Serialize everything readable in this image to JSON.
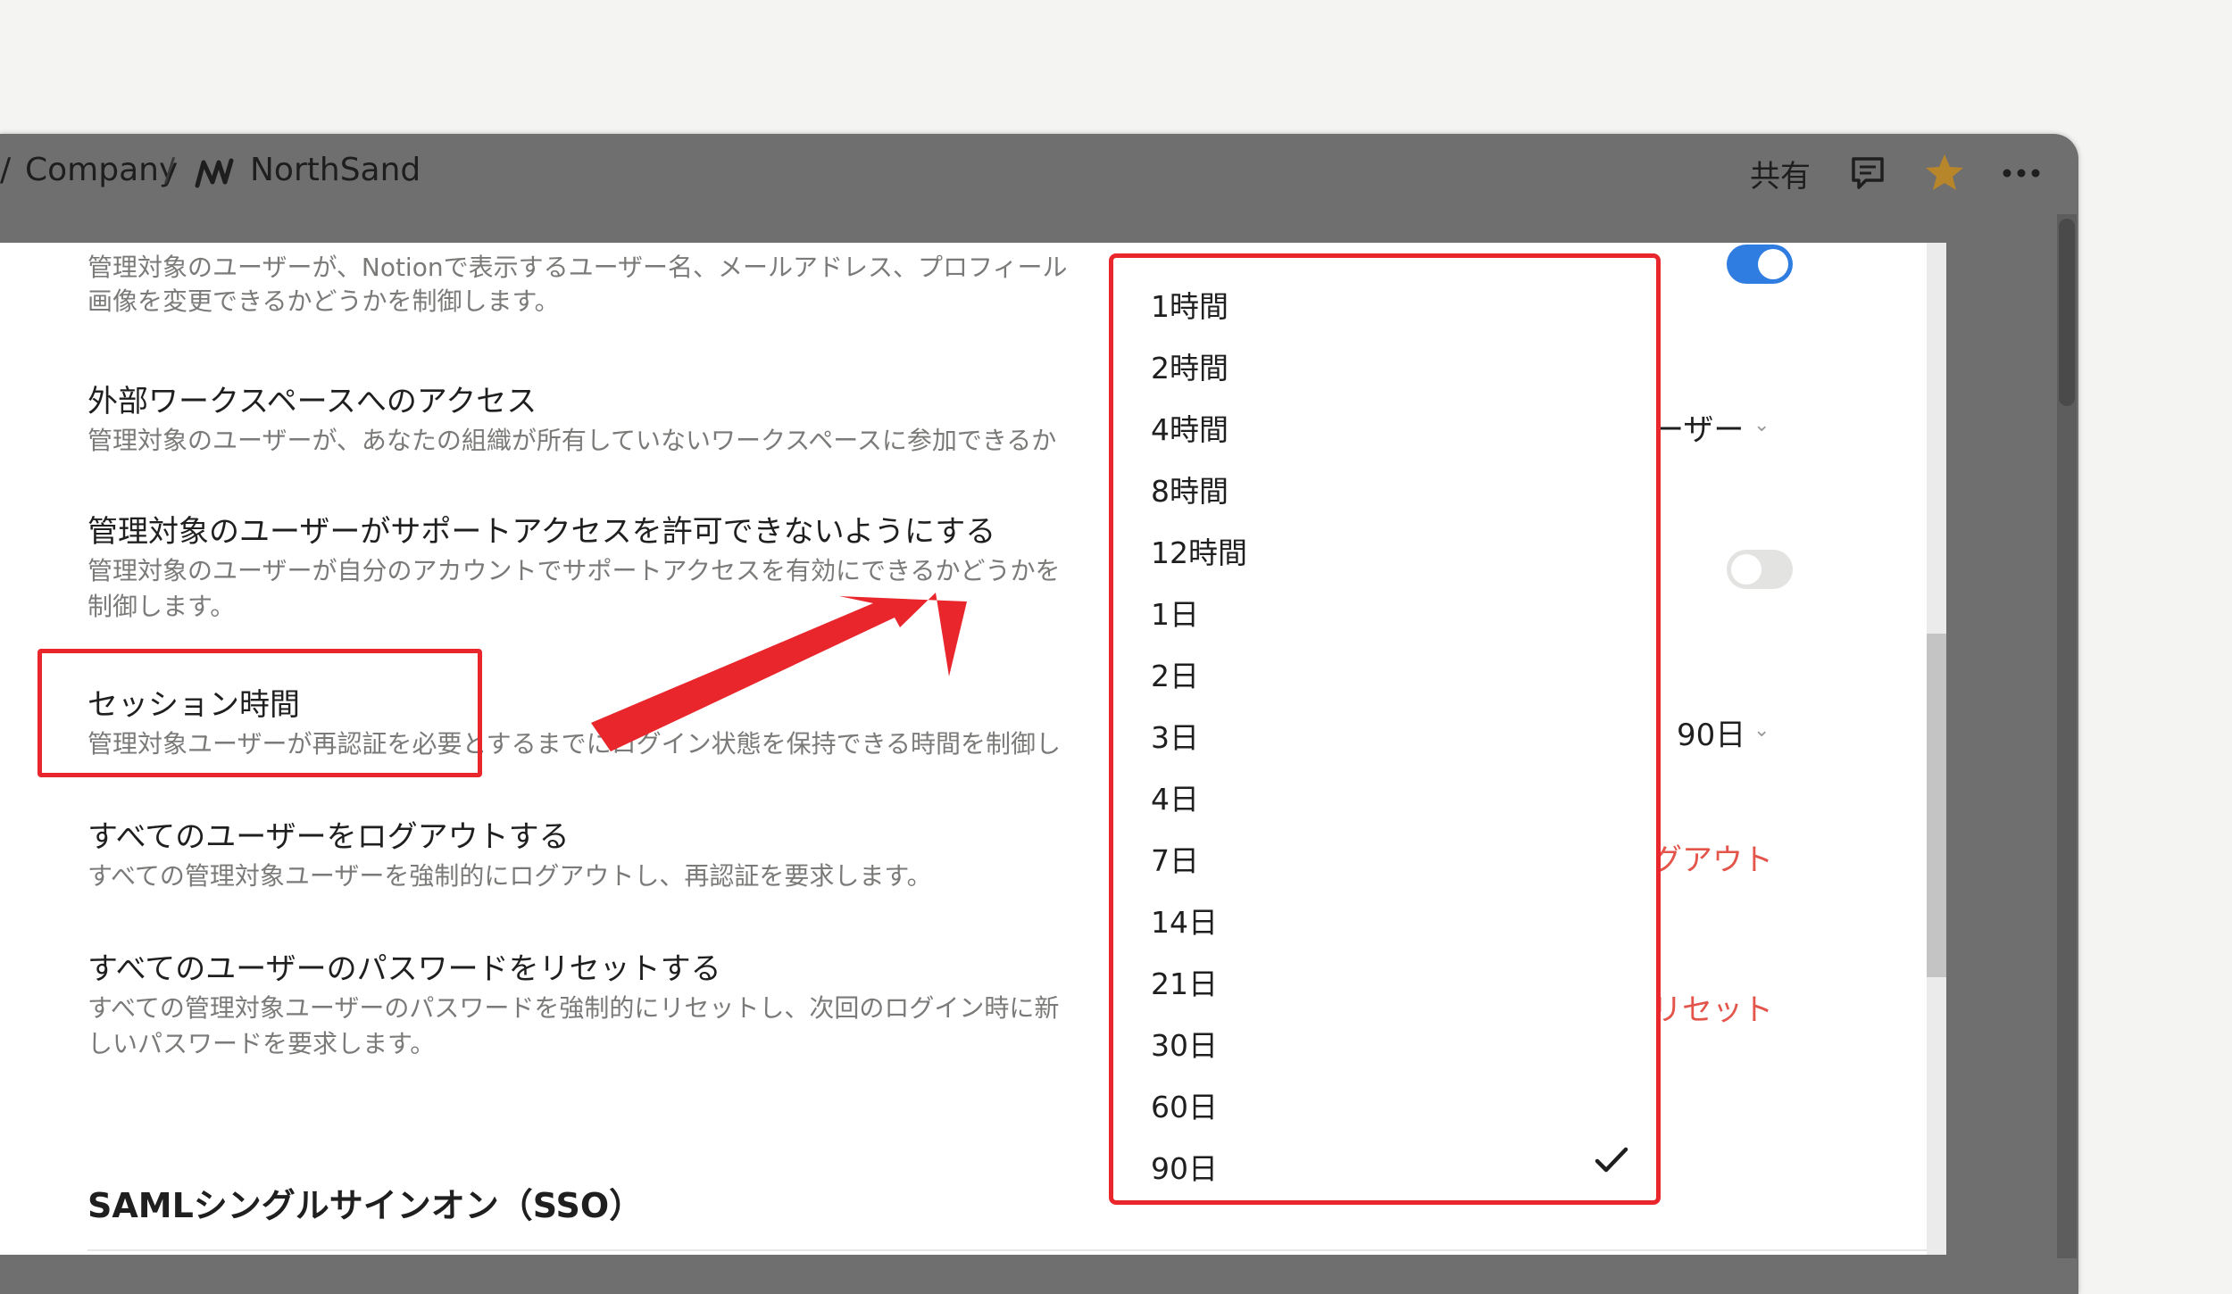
{
  "breadcrumb": {
    "lead_slash": "/",
    "company": "Company",
    "separator": "/",
    "workspace": "NorthSand"
  },
  "topbar": {
    "share_label": "共有",
    "icons": [
      "comment-icon",
      "star-icon",
      "more-icon"
    ],
    "star_color": "#b8862a"
  },
  "settings": {
    "profile_desc_line1": "管理対象のユーザーが、Notionで表示するユーザー名、メールアドレス、プロフィール",
    "profile_desc_line2": "画像を変更できるかどうかを制御します。",
    "profile_toggle_on": true,
    "external_title": "外部ワークスペースへのアクセス",
    "external_desc": "管理対象のユーザーが、あなたの組織が所有していないワークスペースに参加できるか",
    "external_value": "ーザー",
    "support_title": "管理対象のユーザーがサポートアクセスを許可できないようにする",
    "support_desc_line1": "管理対象のユーザーが自分のアカウントでサポートアクセスを有効にできるかどうかを",
    "support_desc_line2": "制御します。",
    "support_toggle_on": false,
    "session_title": "セッション時間",
    "session_desc": "管理対象ユーザーが再認証を必要とするまでにログイン状態を保持できる時間を制御し",
    "session_value": "90日",
    "logout_title": "すべてのユーザーをログアウトする",
    "logout_desc": "すべての管理対象ユーザーを強制的にログアウトし、再認証を要求します。",
    "logout_action": "グアウト",
    "reset_title": "すべてのユーザーのパスワードをリセットする",
    "reset_desc_line1": "すべての管理対象ユーザーのパスワードを強制的にリセットし、次回のログイン時に新",
    "reset_desc_line2": "しいパスワードを要求します。",
    "reset_action": "リセット",
    "saml_heading": "SAMLシングルサインオン（SSO）"
  },
  "dropdown": {
    "options": [
      "1時間",
      "2時間",
      "4時間",
      "8時間",
      "12時間",
      "1日",
      "2日",
      "3日",
      "4日",
      "7日",
      "14日",
      "21日",
      "30日",
      "60日",
      "90日"
    ],
    "selected": "90日"
  },
  "colors": {
    "accent_blue": "#2f7de1",
    "highlight_red": "#e8262c",
    "danger_text": "#e3554a"
  }
}
